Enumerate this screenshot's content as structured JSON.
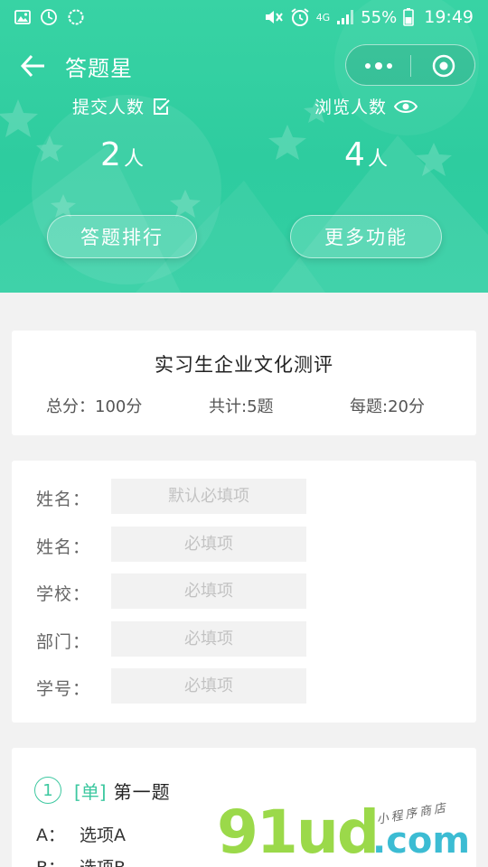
{
  "status_bar": {
    "battery_percent": "55%",
    "time": "19:49",
    "network": "4G",
    "icons": [
      "image-icon",
      "sync-icon",
      "circle-icon",
      "mute-icon",
      "alarm-icon",
      "signal-icon",
      "battery-icon"
    ]
  },
  "nav": {
    "title": "答题星"
  },
  "stats": {
    "submit_label": "提交人数",
    "submit_value": "2",
    "submit_unit": "人",
    "view_label": "浏览人数",
    "view_value": "4",
    "view_unit": "人"
  },
  "buttons": {
    "rank": "答题排行",
    "more": "更多功能"
  },
  "quiz": {
    "title": "实习生企业文化测评",
    "total_score": "总分：100分",
    "question_count": "共计:5题",
    "per_question": "每题:20分"
  },
  "form": {
    "fields": [
      {
        "label": "姓名：",
        "placeholder": "默认必填项"
      },
      {
        "label": "姓名：",
        "placeholder": "必填项"
      },
      {
        "label": "学校：",
        "placeholder": "必填项"
      },
      {
        "label": "部门：",
        "placeholder": "必填项"
      },
      {
        "label": "学号：",
        "placeholder": "必填项"
      }
    ]
  },
  "question": {
    "number": "1",
    "type": "[单]",
    "text": "第一题",
    "options": [
      {
        "letter": "A：",
        "text": "选项A"
      },
      {
        "letter": "B：",
        "text": "选项B"
      }
    ]
  },
  "watermark": {
    "main": "91ud",
    "dot": ".com",
    "small": "小程序商店"
  },
  "colors": {
    "header_green": "#2ecc9f",
    "accent": "#3dc8a0",
    "background": "#f2f2f2",
    "placeholder": "#c3c3c3"
  }
}
